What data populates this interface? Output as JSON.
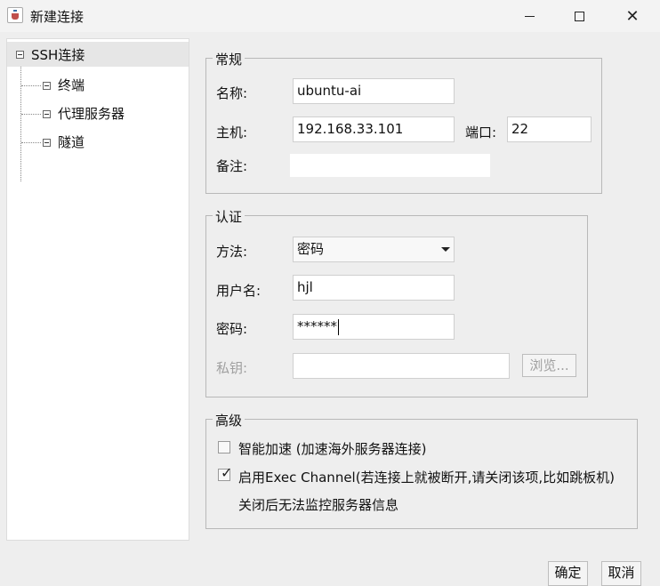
{
  "window": {
    "title": "新建连接"
  },
  "tree": {
    "root": "SSH连接",
    "children": [
      "终端",
      "代理服务器",
      "隧道"
    ]
  },
  "general": {
    "title": "常规",
    "name_label": "名称:",
    "name_value": "ubuntu-ai",
    "host_label": "主机:",
    "host_value": "192.168.33.101",
    "port_label": "端口:",
    "port_value": "22",
    "note_label": "备注:",
    "note_value": ""
  },
  "auth": {
    "title": "认证",
    "method_label": "方法:",
    "method_value": "密码",
    "user_label": "用户名:",
    "user_value": "hjl",
    "password_label": "密码:",
    "password_value": "******",
    "key_label": "私钥:",
    "key_value": "",
    "browse_label": "浏览..."
  },
  "advanced": {
    "title": "高级",
    "accel_label": "智能加速 (加速海外服务器连接)",
    "accel_checked": false,
    "exec_label": "启用Exec Channel(若连接上就被断开,请关闭该项,比如跳板机)",
    "exec_checked": true,
    "exec_note": "关闭后无法监控服务器信息"
  },
  "buttons": {
    "ok": "确定",
    "cancel": "取消"
  }
}
